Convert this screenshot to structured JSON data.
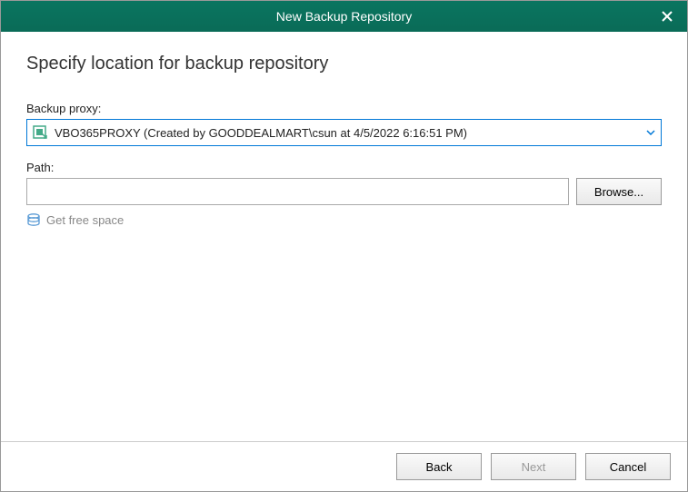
{
  "titlebar": {
    "title": "New Backup Repository"
  },
  "page": {
    "heading": "Specify location for backup repository"
  },
  "proxy": {
    "label": "Backup proxy:",
    "selected": "VBO365PROXY (Created by GOODDEALMART\\csun at 4/5/2022 6:16:51 PM)"
  },
  "path": {
    "label": "Path:",
    "value": "",
    "browse_label": "Browse..."
  },
  "freespace": {
    "label": "Get free space"
  },
  "footer": {
    "back_label": "Back",
    "next_label": "Next",
    "cancel_label": "Cancel"
  }
}
